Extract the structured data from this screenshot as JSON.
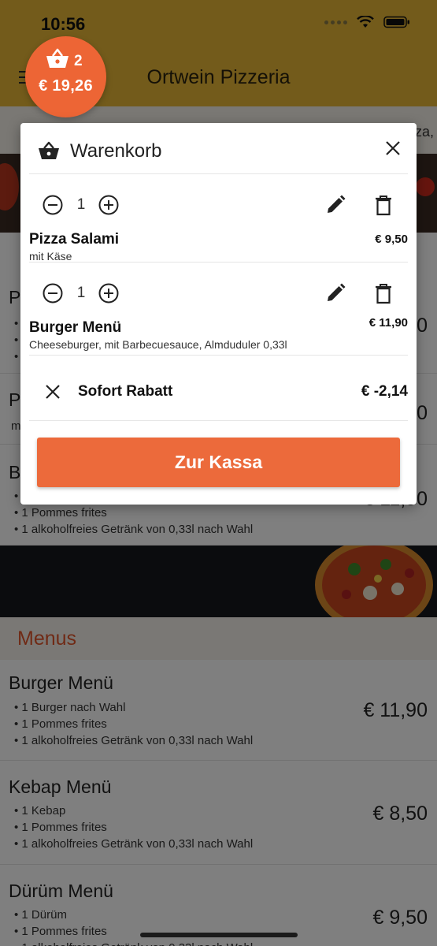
{
  "status_bar": {
    "time": "10:56"
  },
  "header": {
    "title": "Ortwein Pizzeria"
  },
  "cart_bubble": {
    "count": "2",
    "total": "€ 19,26"
  },
  "background": {
    "category_extra": "za,",
    "menu_cards": [
      {
        "name": "P",
        "items": [
          "•",
          "•",
          "•"
        ],
        "price": "0"
      },
      {
        "name": "P",
        "items": [
          "m"
        ],
        "price": "0"
      },
      {
        "name": "B",
        "items": [
          "• 1",
          "• 1 Pommes frites",
          "• 1 alkoholfreies Getränk von 0,33l nach Wahl"
        ],
        "price": "€ 11,90"
      }
    ],
    "section_title": "Menus",
    "menus": [
      {
        "name": "Burger Menü",
        "items": [
          "• 1 Burger nach Wahl",
          "• 1 Pommes frites",
          "• 1 alkoholfreies Getränk von 0,33l nach Wahl"
        ],
        "price": "€ 11,90"
      },
      {
        "name": "Kebap Menü",
        "items": [
          "• 1 Kebap",
          "• 1 Pommes frites",
          "• 1 alkoholfreies Getränk von 0,33l nach Wahl"
        ],
        "price": "€ 8,50"
      },
      {
        "name": "Dürüm Menü",
        "items": [
          "• 1 Dürüm",
          "• 1 Pommes frites",
          "• 1 alkoholfreies Getränk von 0,33l nach Wahl"
        ],
        "price": "€ 9,50"
      }
    ]
  },
  "cart": {
    "title": "Warenkorb",
    "items": [
      {
        "qty": "1",
        "name": "Pizza Salami",
        "desc": "mit Käse",
        "price": "€ 9,50"
      },
      {
        "qty": "1",
        "name": "Burger Menü",
        "desc": "Cheeseburger, mit Barbecuesauce, Almduduler 0,33l",
        "price": "€ 11,90"
      }
    ],
    "discount": {
      "label": "Sofort Rabatt",
      "value": "€ -2,14"
    },
    "checkout_label": "Zur Kassa"
  },
  "colors": {
    "header_bg": "#e6b637",
    "accent": "#ec6a3b",
    "section_title": "#e0552b"
  }
}
